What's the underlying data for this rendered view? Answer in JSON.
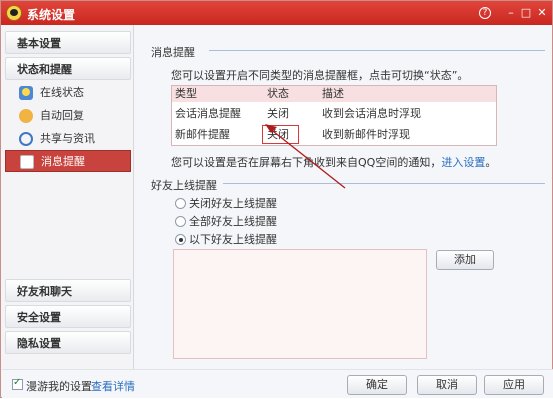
{
  "titlebar": {
    "title": "系统设置",
    "help": "?",
    "minimize": "–",
    "maximize": "□",
    "close": "✕"
  },
  "sidebar": {
    "groups": [
      {
        "label": "基本设置"
      },
      {
        "label": "状态和提醒"
      }
    ],
    "items": [
      {
        "label": "在线状态",
        "icon": "online-status-icon"
      },
      {
        "label": "自动回复",
        "icon": "auto-reply-icon"
      },
      {
        "label": "共享与资讯",
        "icon": "share-news-icon"
      },
      {
        "label": "消息提醒",
        "icon": "message-reminder-icon",
        "active": true
      }
    ],
    "bottom_groups": [
      {
        "label": "好友和聊天"
      },
      {
        "label": "安全设置"
      },
      {
        "label": "隐私设置"
      }
    ]
  },
  "content": {
    "msg_section_title": "消息提醒",
    "msg_intro": "您可以设置开启不同类型的消息提醒框，点击可切换“状态”。",
    "table": {
      "headers": [
        "类型",
        "状态",
        "描述"
      ],
      "rows": [
        [
          "会话消息提醒",
          "关闭",
          "收到会话消息时浮现"
        ],
        [
          "新邮件提醒",
          "关闭",
          "收到新邮件时浮现"
        ]
      ]
    },
    "qzone_note": "您可以设置是否在屏幕右下角收到来自QQ空间的通知，",
    "qzone_link": "进入设置",
    "qzone_end": "。",
    "friend_section_title": "好友上线提醒",
    "radios": [
      {
        "label": "关闭好友上线提醒",
        "checked": false
      },
      {
        "label": "全部好友上线提醒",
        "checked": false
      },
      {
        "label": "以下好友上线提醒",
        "checked": true
      }
    ],
    "add_button": "添加"
  },
  "footer": {
    "roam_checkbox_label": "漫游我的设置",
    "roam_checked": true,
    "details_link": "查看详情",
    "ok": "确定",
    "cancel": "取消",
    "apply": "应用"
  },
  "colors": {
    "title_bar": "#d2332b",
    "active_item": "#c9433e",
    "link": "#2a6ec0",
    "highlight_box": "#d63b3b"
  }
}
